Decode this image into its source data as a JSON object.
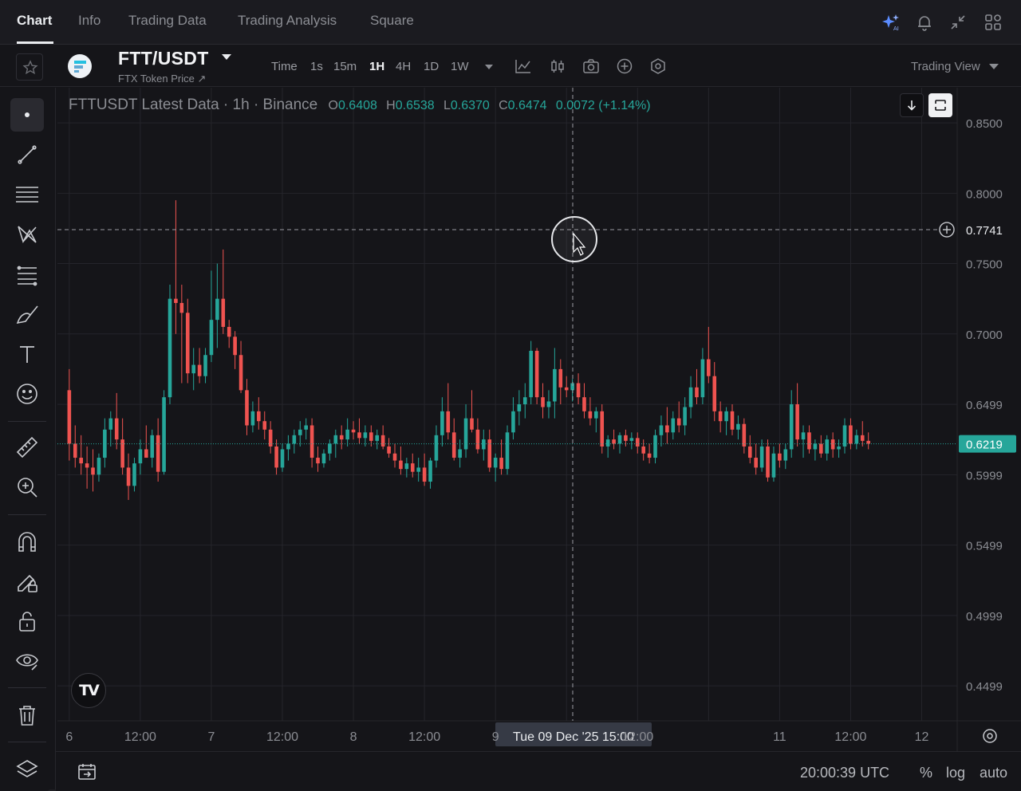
{
  "nav": {
    "tabs": [
      {
        "label": "Chart",
        "active": true
      },
      {
        "label": "Info",
        "active": false
      },
      {
        "label": "Trading Data",
        "active": false
      },
      {
        "label": "Trading Analysis",
        "active": false
      },
      {
        "label": "Square",
        "active": false
      }
    ],
    "right_icons": [
      "ai-sparkle-icon",
      "bell-icon",
      "collapse-icon",
      "layout-grid-icon"
    ]
  },
  "symbol": {
    "pair": "FTT/USDT",
    "subtitle": "FTX Token Price ↗"
  },
  "timeframes": {
    "items": [
      "Time",
      "1s",
      "15m",
      "1H",
      "4H",
      "1D",
      "1W"
    ],
    "active": "1H"
  },
  "chart_tools": [
    "indicator-icon",
    "chart-type-icon",
    "camera-icon",
    "add-icon",
    "settings-icon"
  ],
  "view_selector": "Trading View",
  "legend": {
    "title": "FTTUSDT Latest Data · 1h · Binance",
    "o_key": "O",
    "o": "0.6408",
    "h_key": "H",
    "h": "0.6538",
    "l_key": "L",
    "l": "0.6370",
    "c_key": "C",
    "c": "0.6474",
    "change": "0.0072 (+1.14%)"
  },
  "crosshair": {
    "price_label": "0.7741",
    "time_label": "Tue 09 Dec '25   15:00"
  },
  "last_price": {
    "label": "0.6219",
    "value": 0.6219,
    "color": "#26a69a"
  },
  "colors": {
    "up": "#26a69a",
    "down": "#ef5350",
    "background": "#151519",
    "grid": "#25252b"
  },
  "chart_data": {
    "type": "candlestick",
    "title": "FTTUSDT Latest Data · 1h · Binance",
    "y_ticks": [
      "0.8500",
      "0.8000",
      "0.7500",
      "0.7000",
      "0.6499",
      "0.5999",
      "0.5499",
      "0.4999",
      "0.4499"
    ],
    "y_tick_values": [
      0.85,
      0.8,
      0.75,
      0.7,
      0.6499,
      0.5999,
      0.5499,
      0.4999,
      0.4499
    ],
    "ylim": [
      0.425,
      0.875
    ],
    "x_ticks": [
      "6",
      "12:00",
      "7",
      "12:00",
      "8",
      "12:00",
      "9",
      "12:00",
      "11",
      "12:00",
      "12"
    ],
    "x_tick_hours": [
      0,
      12,
      24,
      36,
      48,
      60,
      72,
      96,
      120,
      132,
      144
    ],
    "x_range_hours": [
      -2,
      150
    ],
    "grid": true,
    "candles": [
      {
        "o": 0.66,
        "h": 0.675,
        "l": 0.61,
        "c": 0.622
      },
      {
        "o": 0.622,
        "h": 0.635,
        "l": 0.605,
        "c": 0.612
      },
      {
        "o": 0.612,
        "h": 0.628,
        "l": 0.6,
        "c": 0.608
      },
      {
        "o": 0.608,
        "h": 0.62,
        "l": 0.59,
        "c": 0.605
      },
      {
        "o": 0.605,
        "h": 0.618,
        "l": 0.588,
        "c": 0.6
      },
      {
        "o": 0.6,
        "h": 0.615,
        "l": 0.595,
        "c": 0.612
      },
      {
        "o": 0.612,
        "h": 0.64,
        "l": 0.605,
        "c": 0.632
      },
      {
        "o": 0.632,
        "h": 0.645,
        "l": 0.62,
        "c": 0.64
      },
      {
        "o": 0.64,
        "h": 0.658,
        "l": 0.618,
        "c": 0.625
      },
      {
        "o": 0.625,
        "h": 0.64,
        "l": 0.6,
        "c": 0.605
      },
      {
        "o": 0.605,
        "h": 0.615,
        "l": 0.582,
        "c": 0.592
      },
      {
        "o": 0.592,
        "h": 0.612,
        "l": 0.588,
        "c": 0.608
      },
      {
        "o": 0.608,
        "h": 0.625,
        "l": 0.6,
        "c": 0.618
      },
      {
        "o": 0.618,
        "h": 0.635,
        "l": 0.612,
        "c": 0.612
      },
      {
        "o": 0.612,
        "h": 0.632,
        "l": 0.605,
        "c": 0.628
      },
      {
        "o": 0.628,
        "h": 0.64,
        "l": 0.595,
        "c": 0.602
      },
      {
        "o": 0.602,
        "h": 0.66,
        "l": 0.6,
        "c": 0.655
      },
      {
        "o": 0.655,
        "h": 0.735,
        "l": 0.65,
        "c": 0.725
      },
      {
        "o": 0.725,
        "h": 0.795,
        "l": 0.7,
        "c": 0.722
      },
      {
        "o": 0.722,
        "h": 0.735,
        "l": 0.665,
        "c": 0.715
      },
      {
        "o": 0.715,
        "h": 0.725,
        "l": 0.665,
        "c": 0.672
      },
      {
        "o": 0.672,
        "h": 0.69,
        "l": 0.66,
        "c": 0.678
      },
      {
        "o": 0.678,
        "h": 0.69,
        "l": 0.665,
        "c": 0.67
      },
      {
        "o": 0.67,
        "h": 0.69,
        "l": 0.665,
        "c": 0.685
      },
      {
        "o": 0.685,
        "h": 0.745,
        "l": 0.68,
        "c": 0.71
      },
      {
        "o": 0.71,
        "h": 0.75,
        "l": 0.69,
        "c": 0.725
      },
      {
        "o": 0.725,
        "h": 0.76,
        "l": 0.7,
        "c": 0.705
      },
      {
        "o": 0.705,
        "h": 0.71,
        "l": 0.69,
        "c": 0.698
      },
      {
        "o": 0.698,
        "h": 0.702,
        "l": 0.675,
        "c": 0.685
      },
      {
        "o": 0.685,
        "h": 0.695,
        "l": 0.658,
        "c": 0.66
      },
      {
        "o": 0.66,
        "h": 0.668,
        "l": 0.628,
        "c": 0.635
      },
      {
        "o": 0.635,
        "h": 0.652,
        "l": 0.63,
        "c": 0.645
      },
      {
        "o": 0.645,
        "h": 0.655,
        "l": 0.632,
        "c": 0.638
      },
      {
        "o": 0.638,
        "h": 0.645,
        "l": 0.625,
        "c": 0.632
      },
      {
        "o": 0.632,
        "h": 0.638,
        "l": 0.615,
        "c": 0.62
      },
      {
        "o": 0.62,
        "h": 0.625,
        "l": 0.6,
        "c": 0.605
      },
      {
        "o": 0.605,
        "h": 0.622,
        "l": 0.602,
        "c": 0.618
      },
      {
        "o": 0.618,
        "h": 0.628,
        "l": 0.61,
        "c": 0.622
      },
      {
        "o": 0.622,
        "h": 0.632,
        "l": 0.615,
        "c": 0.628
      },
      {
        "o": 0.628,
        "h": 0.638,
        "l": 0.62,
        "c": 0.632
      },
      {
        "o": 0.632,
        "h": 0.64,
        "l": 0.625,
        "c": 0.635
      },
      {
        "o": 0.635,
        "h": 0.64,
        "l": 0.605,
        "c": 0.612
      },
      {
        "o": 0.612,
        "h": 0.62,
        "l": 0.602,
        "c": 0.608
      },
      {
        "o": 0.608,
        "h": 0.618,
        "l": 0.605,
        "c": 0.615
      },
      {
        "o": 0.615,
        "h": 0.625,
        "l": 0.61,
        "c": 0.622
      },
      {
        "o": 0.622,
        "h": 0.632,
        "l": 0.612,
        "c": 0.628
      },
      {
        "o": 0.628,
        "h": 0.635,
        "l": 0.618,
        "c": 0.625
      },
      {
        "o": 0.625,
        "h": 0.64,
        "l": 0.62,
        "c": 0.632
      },
      {
        "o": 0.632,
        "h": 0.638,
        "l": 0.625,
        "c": 0.63
      },
      {
        "o": 0.63,
        "h": 0.64,
        "l": 0.622,
        "c": 0.626
      },
      {
        "o": 0.626,
        "h": 0.635,
        "l": 0.62,
        "c": 0.63
      },
      {
        "o": 0.63,
        "h": 0.635,
        "l": 0.62,
        "c": 0.624
      },
      {
        "o": 0.624,
        "h": 0.632,
        "l": 0.618,
        "c": 0.628
      },
      {
        "o": 0.628,
        "h": 0.635,
        "l": 0.618,
        "c": 0.62
      },
      {
        "o": 0.62,
        "h": 0.626,
        "l": 0.612,
        "c": 0.615
      },
      {
        "o": 0.615,
        "h": 0.622,
        "l": 0.605,
        "c": 0.61
      },
      {
        "o": 0.61,
        "h": 0.62,
        "l": 0.6,
        "c": 0.604
      },
      {
        "o": 0.604,
        "h": 0.612,
        "l": 0.598,
        "c": 0.608
      },
      {
        "o": 0.608,
        "h": 0.615,
        "l": 0.598,
        "c": 0.602
      },
      {
        "o": 0.602,
        "h": 0.612,
        "l": 0.595,
        "c": 0.605
      },
      {
        "o": 0.605,
        "h": 0.615,
        "l": 0.592,
        "c": 0.595
      },
      {
        "o": 0.595,
        "h": 0.612,
        "l": 0.59,
        "c": 0.61
      },
      {
        "o": 0.61,
        "h": 0.635,
        "l": 0.605,
        "c": 0.628
      },
      {
        "o": 0.628,
        "h": 0.655,
        "l": 0.62,
        "c": 0.645
      },
      {
        "o": 0.645,
        "h": 0.665,
        "l": 0.625,
        "c": 0.63
      },
      {
        "o": 0.63,
        "h": 0.64,
        "l": 0.61,
        "c": 0.612
      },
      {
        "o": 0.612,
        "h": 0.625,
        "l": 0.605,
        "c": 0.618
      },
      {
        "o": 0.618,
        "h": 0.65,
        "l": 0.612,
        "c": 0.64
      },
      {
        "o": 0.64,
        "h": 0.66,
        "l": 0.63,
        "c": 0.632
      },
      {
        "o": 0.632,
        "h": 0.64,
        "l": 0.615,
        "c": 0.618
      },
      {
        "o": 0.618,
        "h": 0.632,
        "l": 0.61,
        "c": 0.625
      },
      {
        "o": 0.625,
        "h": 0.632,
        "l": 0.602,
        "c": 0.605
      },
      {
        "o": 0.605,
        "h": 0.615,
        "l": 0.595,
        "c": 0.612
      },
      {
        "o": 0.612,
        "h": 0.625,
        "l": 0.6,
        "c": 0.604
      },
      {
        "o": 0.604,
        "h": 0.635,
        "l": 0.6,
        "c": 0.63
      },
      {
        "o": 0.63,
        "h": 0.655,
        "l": 0.625,
        "c": 0.645
      },
      {
        "o": 0.645,
        "h": 0.66,
        "l": 0.635,
        "c": 0.65
      },
      {
        "o": 0.65,
        "h": 0.665,
        "l": 0.64,
        "c": 0.655
      },
      {
        "o": 0.655,
        "h": 0.695,
        "l": 0.65,
        "c": 0.688
      },
      {
        "o": 0.688,
        "h": 0.69,
        "l": 0.65,
        "c": 0.655
      },
      {
        "o": 0.655,
        "h": 0.665,
        "l": 0.64,
        "c": 0.648
      },
      {
        "o": 0.648,
        "h": 0.66,
        "l": 0.64,
        "c": 0.652
      },
      {
        "o": 0.652,
        "h": 0.69,
        "l": 0.64,
        "c": 0.675
      },
      {
        "o": 0.675,
        "h": 0.682,
        "l": 0.65,
        "c": 0.662
      },
      {
        "o": 0.662,
        "h": 0.67,
        "l": 0.655,
        "c": 0.66
      },
      {
        "o": 0.66,
        "h": 0.668,
        "l": 0.652,
        "c": 0.665
      },
      {
        "o": 0.665,
        "h": 0.672,
        "l": 0.65,
        "c": 0.655
      },
      {
        "o": 0.655,
        "h": 0.665,
        "l": 0.64,
        "c": 0.645
      },
      {
        "o": 0.645,
        "h": 0.655,
        "l": 0.635,
        "c": 0.64
      },
      {
        "o": 0.64,
        "h": 0.648,
        "l": 0.63,
        "c": 0.645
      },
      {
        "o": 0.645,
        "h": 0.65,
        "l": 0.615,
        "c": 0.62
      },
      {
        "o": 0.62,
        "h": 0.628,
        "l": 0.612,
        "c": 0.625
      },
      {
        "o": 0.625,
        "h": 0.632,
        "l": 0.618,
        "c": 0.622
      },
      {
        "o": 0.622,
        "h": 0.63,
        "l": 0.615,
        "c": 0.628
      },
      {
        "o": 0.628,
        "h": 0.632,
        "l": 0.62,
        "c": 0.624
      },
      {
        "o": 0.624,
        "h": 0.63,
        "l": 0.618,
        "c": 0.626
      },
      {
        "o": 0.626,
        "h": 0.63,
        "l": 0.615,
        "c": 0.62
      },
      {
        "o": 0.62,
        "h": 0.625,
        "l": 0.61,
        "c": 0.615
      },
      {
        "o": 0.615,
        "h": 0.622,
        "l": 0.608,
        "c": 0.612
      },
      {
        "o": 0.612,
        "h": 0.632,
        "l": 0.608,
        "c": 0.628
      },
      {
        "o": 0.628,
        "h": 0.642,
        "l": 0.62,
        "c": 0.635
      },
      {
        "o": 0.635,
        "h": 0.648,
        "l": 0.622,
        "c": 0.63
      },
      {
        "o": 0.63,
        "h": 0.645,
        "l": 0.625,
        "c": 0.64
      },
      {
        "o": 0.64,
        "h": 0.652,
        "l": 0.63,
        "c": 0.635
      },
      {
        "o": 0.635,
        "h": 0.655,
        "l": 0.628,
        "c": 0.648
      },
      {
        "o": 0.648,
        "h": 0.67,
        "l": 0.64,
        "c": 0.662
      },
      {
        "o": 0.662,
        "h": 0.675,
        "l": 0.65,
        "c": 0.655
      },
      {
        "o": 0.655,
        "h": 0.69,
        "l": 0.65,
        "c": 0.682
      },
      {
        "o": 0.682,
        "h": 0.705,
        "l": 0.665,
        "c": 0.67
      },
      {
        "o": 0.67,
        "h": 0.68,
        "l": 0.638,
        "c": 0.645
      },
      {
        "o": 0.645,
        "h": 0.652,
        "l": 0.63,
        "c": 0.638
      },
      {
        "o": 0.638,
        "h": 0.648,
        "l": 0.628,
        "c": 0.645
      },
      {
        "o": 0.645,
        "h": 0.65,
        "l": 0.628,
        "c": 0.632
      },
      {
        "o": 0.632,
        "h": 0.642,
        "l": 0.625,
        "c": 0.636
      },
      {
        "o": 0.636,
        "h": 0.64,
        "l": 0.615,
        "c": 0.62
      },
      {
        "o": 0.62,
        "h": 0.628,
        "l": 0.608,
        "c": 0.612
      },
      {
        "o": 0.612,
        "h": 0.622,
        "l": 0.6,
        "c": 0.605
      },
      {
        "o": 0.605,
        "h": 0.625,
        "l": 0.602,
        "c": 0.62
      },
      {
        "o": 0.62,
        "h": 0.625,
        "l": 0.595,
        "c": 0.598
      },
      {
        "o": 0.598,
        "h": 0.62,
        "l": 0.595,
        "c": 0.615
      },
      {
        "o": 0.615,
        "h": 0.622,
        "l": 0.605,
        "c": 0.61
      },
      {
        "o": 0.61,
        "h": 0.622,
        "l": 0.604,
        "c": 0.618
      },
      {
        "o": 0.618,
        "h": 0.66,
        "l": 0.612,
        "c": 0.65
      },
      {
        "o": 0.65,
        "h": 0.665,
        "l": 0.62,
        "c": 0.625
      },
      {
        "o": 0.625,
        "h": 0.635,
        "l": 0.612,
        "c": 0.63
      },
      {
        "o": 0.63,
        "h": 0.635,
        "l": 0.615,
        "c": 0.618
      },
      {
        "o": 0.618,
        "h": 0.625,
        "l": 0.61,
        "c": 0.622
      },
      {
        "o": 0.622,
        "h": 0.628,
        "l": 0.612,
        "c": 0.615
      },
      {
        "o": 0.615,
        "h": 0.628,
        "l": 0.61,
        "c": 0.625
      },
      {
        "o": 0.625,
        "h": 0.63,
        "l": 0.612,
        "c": 0.618
      },
      {
        "o": 0.618,
        "h": 0.625,
        "l": 0.612,
        "c": 0.62
      },
      {
        "o": 0.62,
        "h": 0.64,
        "l": 0.615,
        "c": 0.635
      },
      {
        "o": 0.635,
        "h": 0.64,
        "l": 0.618,
        "c": 0.622
      },
      {
        "o": 0.622,
        "h": 0.632,
        "l": 0.618,
        "c": 0.628
      },
      {
        "o": 0.628,
        "h": 0.638,
        "l": 0.62,
        "c": 0.624
      },
      {
        "o": 0.624,
        "h": 0.63,
        "l": 0.618,
        "c": 0.622
      }
    ],
    "crosshair_time": "Tue 09 Dec '25   15:00",
    "crosshair_price": 0.7741
  },
  "bottom": {
    "time": "20:00:39 UTC",
    "percent": "%",
    "log": "log",
    "auto": "auto"
  },
  "left_tools": [
    "cursor-dot-icon",
    "trendline-icon",
    "horizontal-lines-icon",
    "pattern-icon",
    "fib-icon",
    "brush-icon",
    "text-icon",
    "emoji-icon",
    "ruler-icon",
    "zoom-in-icon",
    "magnet-icon",
    "lock-draw-icon",
    "unlock-icon",
    "eye-icon",
    "trash-icon",
    "layers-icon"
  ]
}
